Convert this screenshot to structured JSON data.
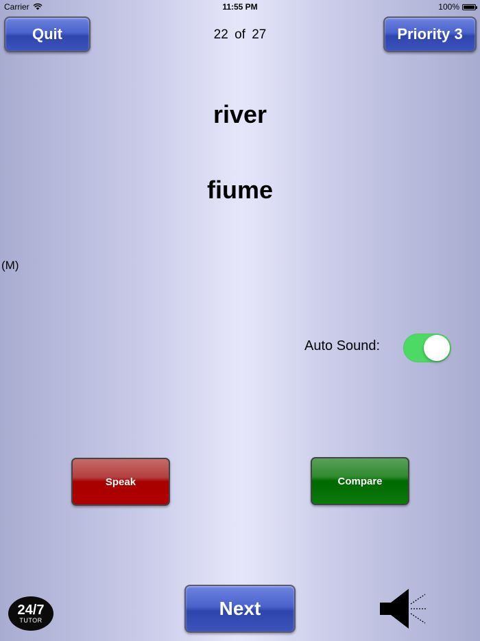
{
  "status_bar": {
    "carrier": "Carrier",
    "time": "11:55 PM",
    "battery": "100%"
  },
  "header": {
    "quit_label": "Quit",
    "progress": "22 of 27",
    "priority_label": "Priority 3"
  },
  "card": {
    "word": "river",
    "translation": "fiume",
    "gender": "(M)"
  },
  "settings": {
    "auto_sound_label": "Auto Sound:",
    "auto_sound_on": true
  },
  "actions": {
    "speak_label": "Speak",
    "compare_label": "Compare",
    "next_label": "Next"
  },
  "logo": {
    "main": "24/7",
    "sub": "TUTOR"
  },
  "colors": {
    "toggle_on": "#4cd964",
    "speak": "#a80000",
    "compare": "#006800",
    "primary_button": "#3c53bb"
  },
  "icons": [
    "wifi-icon",
    "battery-icon",
    "speaker-icon"
  ]
}
